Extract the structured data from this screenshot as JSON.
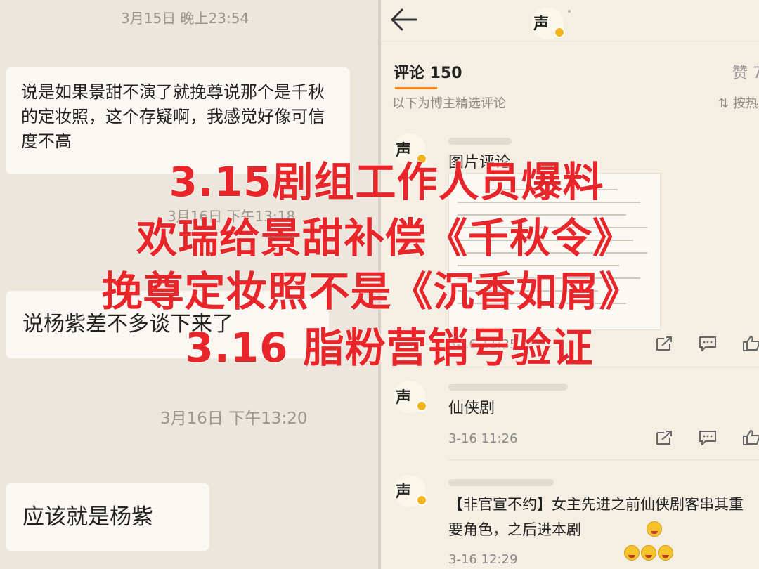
{
  "chat": {
    "timestamps": [
      "3月15日 晚上23:54",
      "3月16日 下午13:18",
      "3月16日 下午13:20"
    ],
    "messages": [
      "说是如果景甜不演了就挽尊说那个是千秋的定妆照，这个存疑啊，我感觉好像可信度不高",
      "说杨紫差不多谈下来了",
      "应该就是杨紫"
    ]
  },
  "weibo": {
    "comments_tab": "评论 150",
    "likes_tab": "赞 7",
    "curated_note": "以下为博主精选评论",
    "sort_button": "按热",
    "comments": [
      {
        "text": "图片评论",
        "time": "3-16 11:35"
      },
      {
        "text": "仙侠剧",
        "time": "3-16 11:26"
      },
      {
        "text": "【非官宣不约】女主先进之前仙侠剧客串其重要角色，之后进本剧",
        "time": "3-16 12:29"
      }
    ]
  },
  "overlay": {
    "lines": [
      "3.15剧组工作人员爆料",
      "欢瑞给景甜补偿《千秋令》",
      "挽尊定妆照不是《沉香如屑》",
      "3.16 脂粉营销号验证"
    ],
    "color": "#e8262a"
  },
  "icons": [
    "back-arrow-icon",
    "share-icon",
    "comment-icon",
    "like-icon",
    "emoji-icon"
  ]
}
